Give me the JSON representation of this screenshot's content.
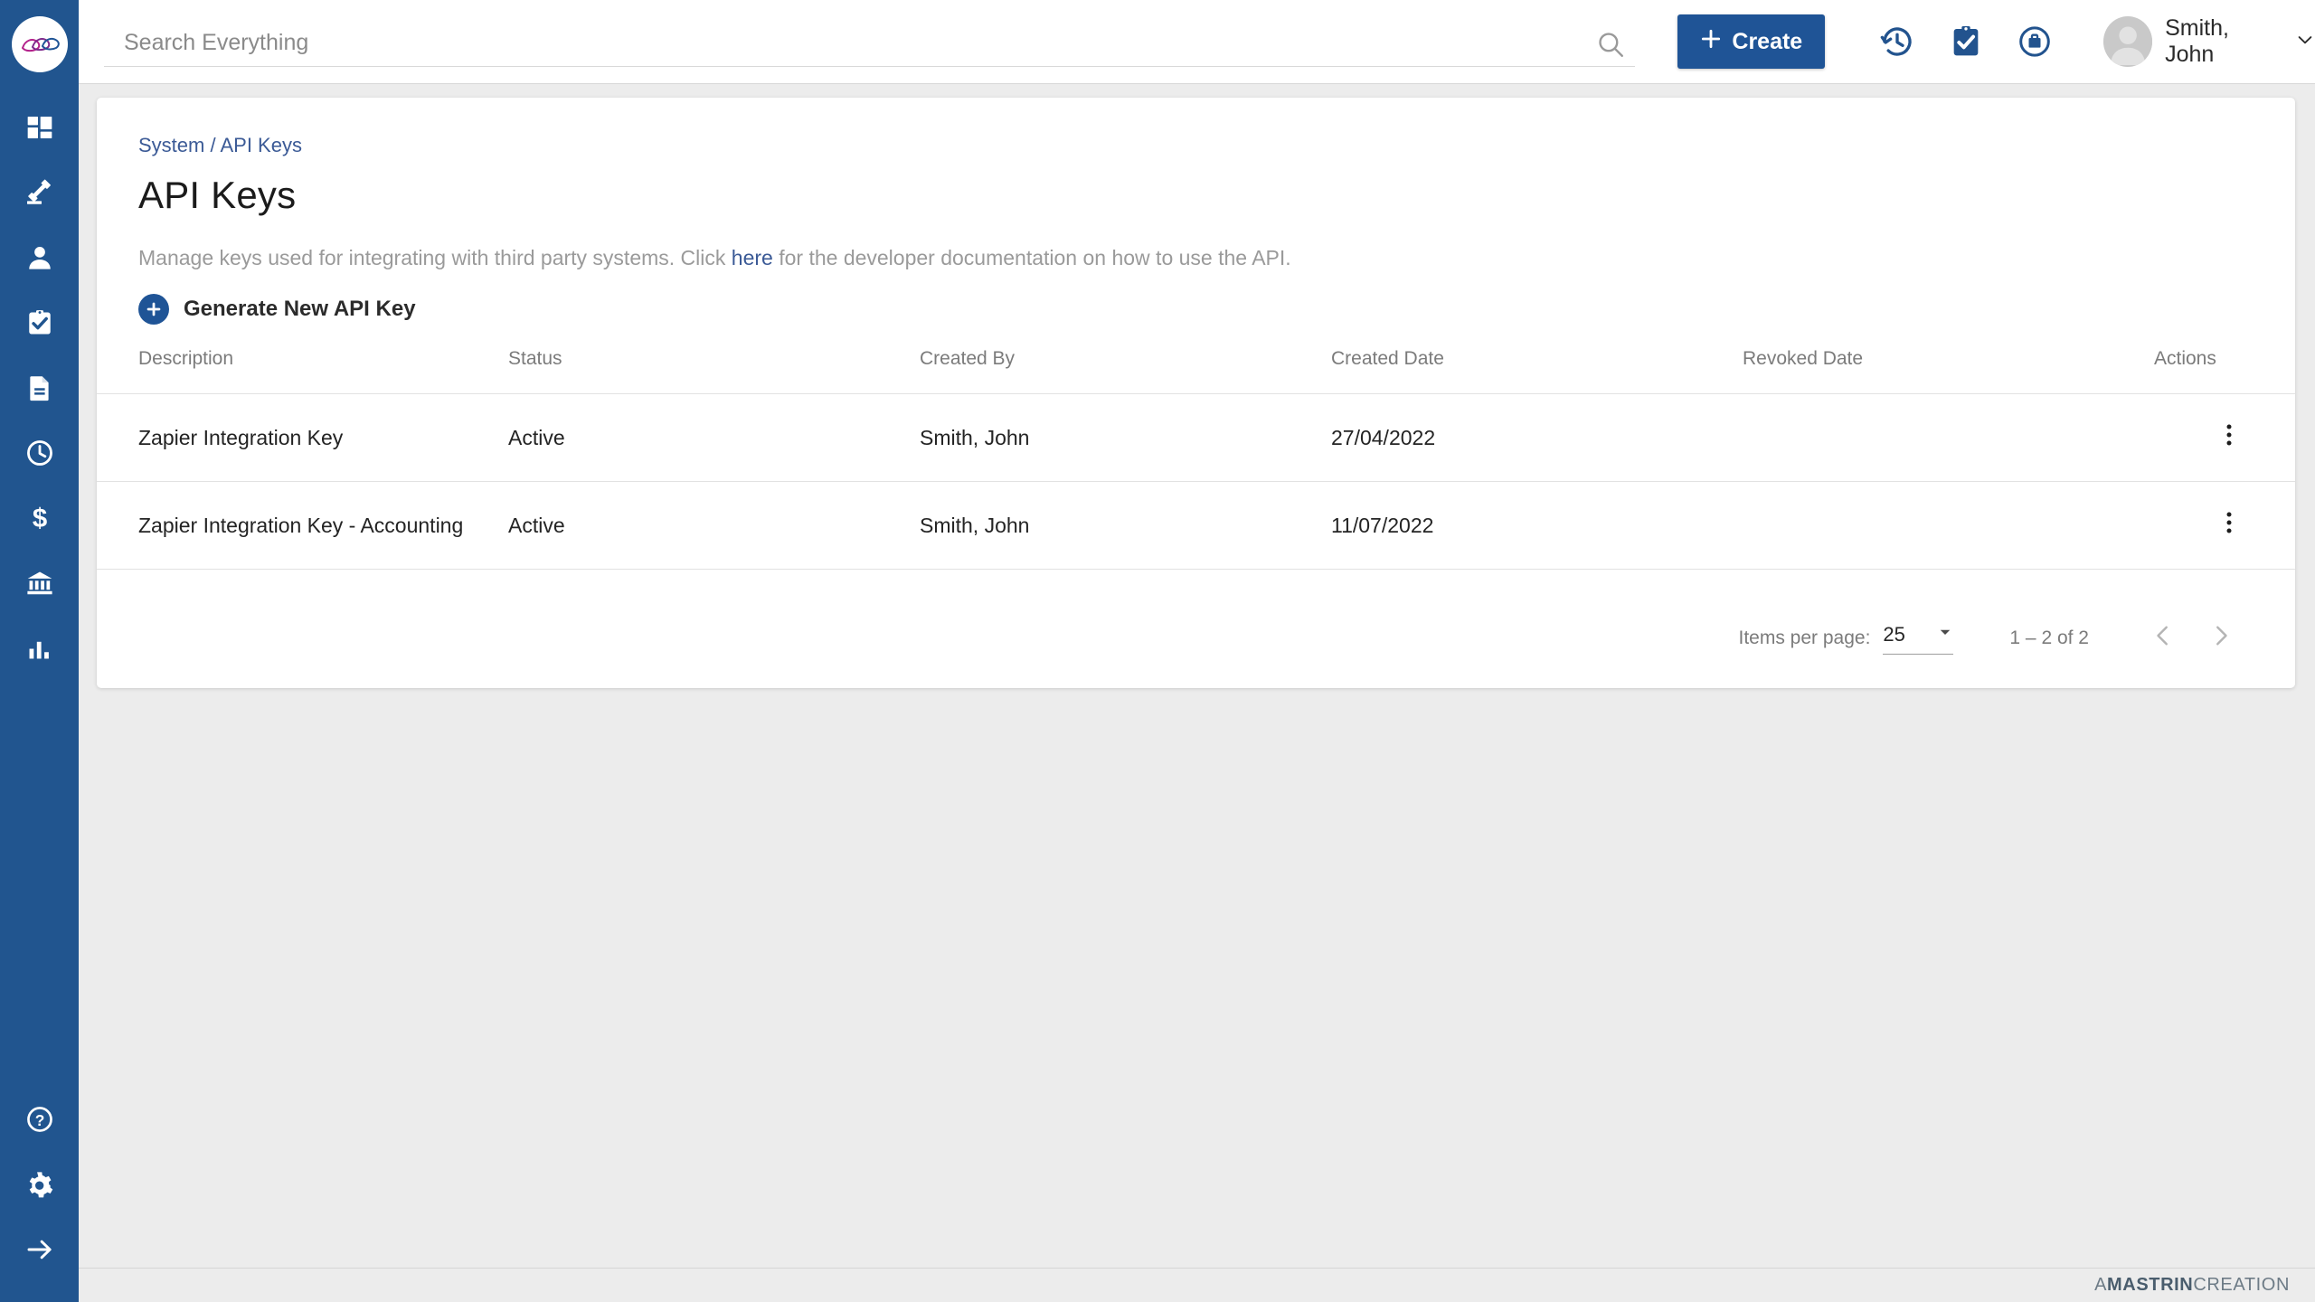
{
  "brand": {
    "logo_name": "mastrin-logo",
    "sidebar_color": "#21558f",
    "accent_color": "#1f5496",
    "link_color": "#3b5a96"
  },
  "sidebar": {
    "top_items": [
      {
        "name": "dashboard",
        "icon": "dashboard-grid-icon"
      },
      {
        "name": "matters",
        "icon": "gavel-icon"
      },
      {
        "name": "contacts",
        "icon": "person-icon"
      },
      {
        "name": "tasks",
        "icon": "clipboard-check-icon"
      },
      {
        "name": "documents",
        "icon": "document-icon"
      },
      {
        "name": "time",
        "icon": "clock-icon"
      },
      {
        "name": "billing",
        "icon": "dollar-icon"
      },
      {
        "name": "accounts",
        "icon": "bank-icon"
      },
      {
        "name": "reports",
        "icon": "bar-chart-icon"
      }
    ],
    "bottom_items": [
      {
        "name": "help",
        "icon": "help-circle-icon"
      },
      {
        "name": "settings",
        "icon": "gear-icon"
      },
      {
        "name": "expand",
        "icon": "arrow-right-icon"
      }
    ]
  },
  "topbar": {
    "search": {
      "placeholder": "Search Everything",
      "value": "",
      "icon": "search-icon"
    },
    "create_label": "Create",
    "icons": [
      {
        "name": "recent-history-icon"
      },
      {
        "name": "clipboard-check-icon"
      },
      {
        "name": "briefcase-circle-icon"
      }
    ],
    "user": {
      "name": "Smith, John",
      "avatar": "avatar",
      "chevron": "chevron-down-icon"
    }
  },
  "page": {
    "breadcrumb": "System / API Keys",
    "title": "API Keys",
    "description_before": "Manage keys used for integrating with third party systems. Click ",
    "description_link": "here",
    "description_after": " for the developer documentation on how to use the API.",
    "generate_label": "Generate New API Key"
  },
  "table": {
    "columns": [
      "Description",
      "Status",
      "Created By",
      "Created Date",
      "Revoked Date",
      "Actions"
    ],
    "rows": [
      {
        "description": "Zapier Integration Key",
        "status": "Active",
        "created_by": "Smith, John",
        "created_date": "27/04/2022",
        "revoked_date": "",
        "action_icon": "kebab-menu-icon"
      },
      {
        "description": "Zapier Integration Key - Accounting",
        "status": "Active",
        "created_by": "Smith, John",
        "created_date": "11/07/2022",
        "revoked_date": "",
        "action_icon": "kebab-menu-icon"
      }
    ]
  },
  "paginator": {
    "items_per_page_label": "Items per page:",
    "items_per_page_value": "25",
    "range_label": "1 – 2 of 2",
    "prev_icon": "chevron-left-icon",
    "next_icon": "chevron-right-icon"
  },
  "footer": {
    "prefix": "A ",
    "brand": "MASTRIN",
    "suffix": " CREATION"
  }
}
